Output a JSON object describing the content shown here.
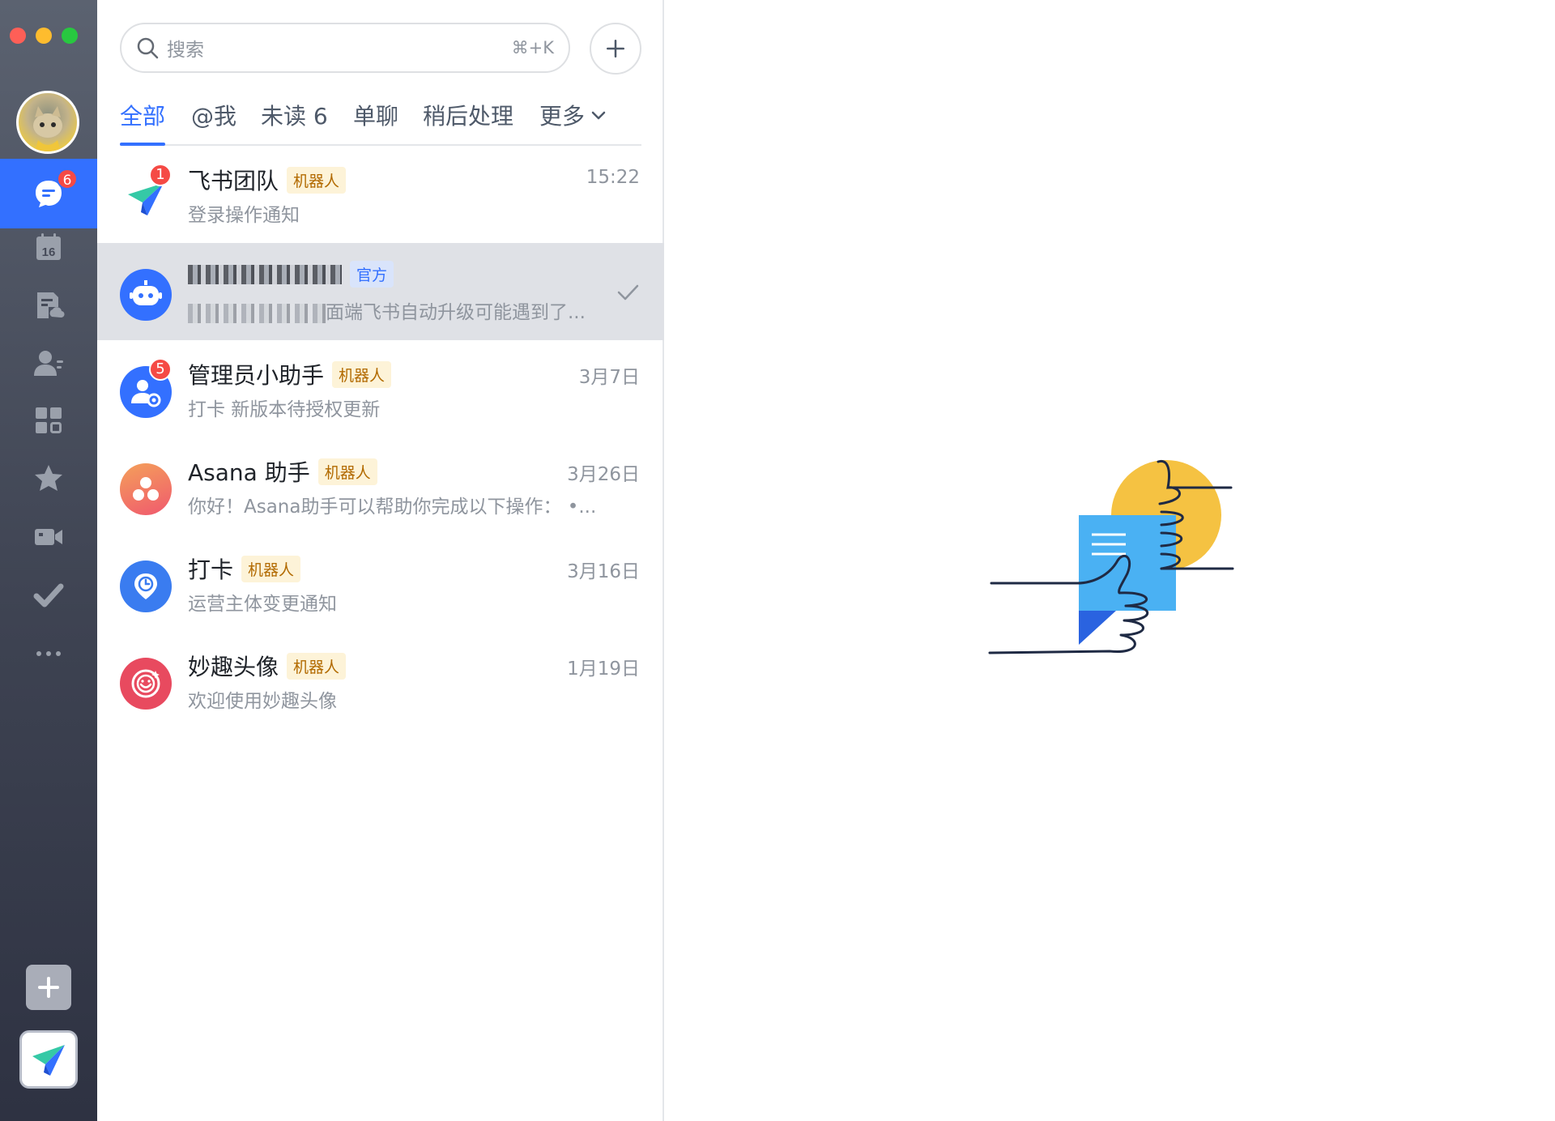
{
  "window": {
    "controls": [
      "close",
      "minimize",
      "zoom"
    ]
  },
  "rail": {
    "user_avatar": "user-avatar",
    "items": [
      {
        "id": "messages",
        "icon": "chat-bubble-icon",
        "badge": "6",
        "active": true
      },
      {
        "id": "calendar",
        "icon": "calendar-icon",
        "label": "16"
      },
      {
        "id": "docs",
        "icon": "cloud-doc-icon"
      },
      {
        "id": "contacts",
        "icon": "contacts-icon"
      },
      {
        "id": "workplace",
        "icon": "app-grid-icon"
      },
      {
        "id": "favorites",
        "icon": "star-icon"
      },
      {
        "id": "meetings",
        "icon": "video-icon"
      },
      {
        "id": "approval",
        "icon": "check-icon"
      },
      {
        "id": "more",
        "icon": "more-icon"
      }
    ],
    "add_icon": "plus-icon",
    "app_icon": "feishu-logo-icon"
  },
  "search": {
    "placeholder": "搜索",
    "shortcut": "⌘+K"
  },
  "tabs": [
    {
      "label": "全部",
      "active": true
    },
    {
      "label": "@我"
    },
    {
      "label": "未读 6"
    },
    {
      "label": "单聊"
    },
    {
      "label": "稍后处理"
    },
    {
      "label": "更多"
    }
  ],
  "chats": [
    {
      "name": "飞书团队",
      "tag": "机器人",
      "time": "15:22",
      "message": "登录操作通知",
      "badge": "1",
      "avatar": "feishu-logo-icon"
    },
    {
      "name": "",
      "tag": "官方",
      "time": "",
      "message": "面端飞书自动升级可能遇到了...",
      "badge": "",
      "avatar": "robot-icon",
      "selected": true,
      "done": true
    },
    {
      "name": "管理员小助手",
      "tag": "机器人",
      "time": "3月7日",
      "message": "打卡 新版本待授权更新",
      "badge": "5",
      "avatar": "admin-gear-icon"
    },
    {
      "name": "Asana 助手",
      "tag": "机器人",
      "time": "3月26日",
      "message": "你好！Asana助手可以帮助你完成以下操作：  •...",
      "badge": "",
      "avatar": "asana-icon"
    },
    {
      "name": "打卡",
      "tag": "机器人",
      "time": "3月16日",
      "message": "运营主体变更通知",
      "badge": "",
      "avatar": "clock-pin-icon"
    },
    {
      "name": "妙趣头像",
      "tag": "机器人",
      "time": "1月19日",
      "message": "欢迎使用妙趣头像",
      "badge": "",
      "avatar": "smile-icon"
    }
  ],
  "colors": {
    "accent": "#3370ff",
    "badge": "#f54a45",
    "tag_bg": "#fdf3d8",
    "tag_text": "#b26a00"
  },
  "empty_state": {
    "illustration": "thumbs-up-illustration"
  }
}
